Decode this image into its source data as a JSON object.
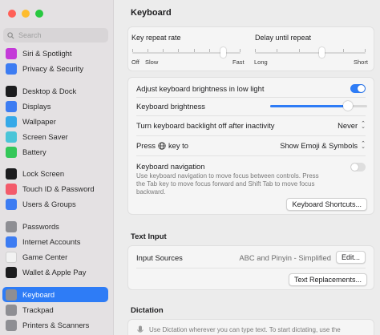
{
  "colors": {
    "accent": "#2e7cf6",
    "red": "#ff5f57",
    "yellow": "#febc2e",
    "green": "#28c840"
  },
  "sidebar": {
    "search_placeholder": "Search",
    "items": [
      {
        "label": "Siri & Spotlight",
        "icon": "siri-icon",
        "color": "#c43ad8"
      },
      {
        "label": "Privacy & Security",
        "icon": "hand-icon",
        "color": "#3d7cf2"
      },
      {
        "label": "Desktop & Dock",
        "icon": "dock-icon",
        "color": "#1c1c1e"
      },
      {
        "label": "Displays",
        "icon": "sun-icon",
        "color": "#3d7cf2"
      },
      {
        "label": "Wallpaper",
        "icon": "wallpaper-icon",
        "color": "#35a9e8"
      },
      {
        "label": "Screen Saver",
        "icon": "screensaver-icon",
        "color": "#4ac5d8"
      },
      {
        "label": "Battery",
        "icon": "battery-icon",
        "color": "#34c759"
      },
      {
        "label": "Lock Screen",
        "icon": "lock-icon",
        "color": "#1c1c1e"
      },
      {
        "label": "Touch ID & Password",
        "icon": "fingerprint-icon",
        "color": "#f35b6b"
      },
      {
        "label": "Users & Groups",
        "icon": "users-icon",
        "color": "#3d7cf2"
      },
      {
        "label": "Passwords",
        "icon": "key-icon",
        "color": "#8e8e93"
      },
      {
        "label": "Internet Accounts",
        "icon": "at-icon",
        "color": "#3d7cf2"
      },
      {
        "label": "Game Center",
        "icon": "game-center-icon",
        "color": "#f2f2f2"
      },
      {
        "label": "Wallet & Apple Pay",
        "icon": "wallet-icon",
        "color": "#1c1c1e"
      },
      {
        "label": "Keyboard",
        "icon": "keyboard-icon",
        "color": "#8e8e93"
      },
      {
        "label": "Trackpad",
        "icon": "trackpad-icon",
        "color": "#8e8e93"
      },
      {
        "label": "Printers & Scanners",
        "icon": "printer-icon",
        "color": "#8e8e93"
      }
    ]
  },
  "main": {
    "title": "Keyboard",
    "key_repeat": {
      "label": "Key repeat rate",
      "labels": [
        "Off",
        "Slow",
        "Fast"
      ],
      "value": 0.84
    },
    "delay_repeat": {
      "label": "Delay until repeat",
      "labels": [
        "Long",
        "Short"
      ],
      "value": 0.6
    },
    "adjust_brightness": {
      "label": "Adjust keyboard brightness in low light",
      "on": true
    },
    "keyboard_brightness": {
      "label": "Keyboard brightness",
      "value": 0.8
    },
    "backlight_off": {
      "label": "Turn keyboard backlight off after inactivity",
      "value": "Never"
    },
    "press_key": {
      "label_before": "Press",
      "label_after": "key to",
      "value": "Show Emoji & Symbols"
    },
    "keyboard_navigation": {
      "label": "Keyboard navigation",
      "description": "Use keyboard navigation to move focus between controls. Press the Tab key to move focus forward and Shift Tab to move focus backward.",
      "on": false
    },
    "shortcuts_button": "Keyboard Shortcuts...",
    "text_input": {
      "title": "Text Input",
      "input_sources_label": "Input Sources",
      "input_sources_value": "ABC and Pinyin - Simplified",
      "edit_button": "Edit...",
      "replacements_button": "Text Replacements..."
    },
    "dictation": {
      "title": "Dictation",
      "description": "Use Dictation wherever you can type text. To start dictating, use the"
    }
  }
}
